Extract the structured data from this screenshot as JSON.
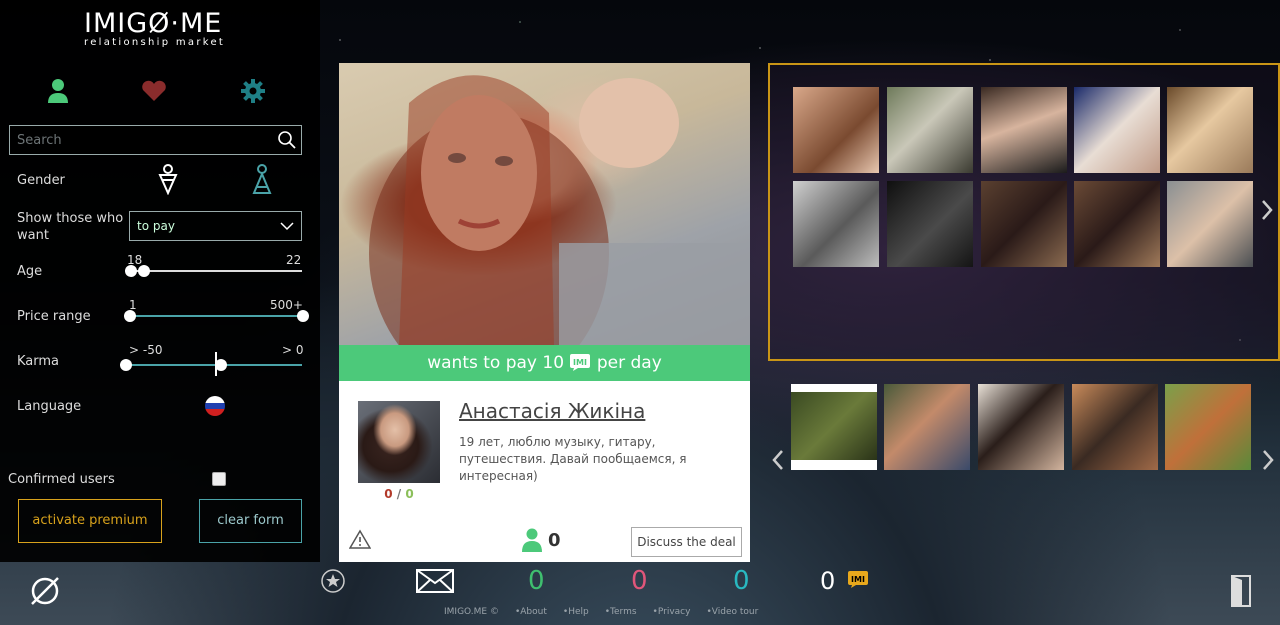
{
  "logo": {
    "main": "IMIGØ·ME",
    "sub": "relationship market"
  },
  "sidebar": {
    "tabs": [
      {
        "icon": "user-icon",
        "color": "#4cc97a"
      },
      {
        "icon": "heart-icon",
        "color": "#8a2c2c"
      },
      {
        "icon": "settings-gear-icon",
        "color": "#1f7f86"
      }
    ],
    "search_placeholder": "Search",
    "gender_label": "Gender",
    "show_label": "Show those who want",
    "show_value": "to pay",
    "age_label": "Age",
    "age_min": "18",
    "age_max": "22",
    "price_label": "Price range",
    "price_min": "1",
    "price_max": "500+",
    "karma_label": "Karma",
    "karma_min": "> -50",
    "karma_max": "> 0",
    "language_label": "Language",
    "confirmed_label": "Confirmed users",
    "premium_button": "activate premium",
    "clear_button": "clear form"
  },
  "profile": {
    "deal_prefix": "wants to pay 10",
    "deal_suffix": "per day",
    "name": "Анастасія Жикіна",
    "bio": "19 лет, люблю музыку, гитару, путешествия. Давай пообщаемся, я интересная)",
    "counts_red": "0",
    "counts_sep": " / ",
    "counts_green": "0",
    "likes": "0",
    "discuss_button": "Discuss the deal"
  },
  "bottom": {
    "counters": [
      {
        "value": "0",
        "color": "#3fbf6f"
      },
      {
        "value": "0",
        "color": "#e0567a"
      },
      {
        "value": "0",
        "color": "#29b8c0"
      },
      {
        "value": "0",
        "color": "#ffffff"
      }
    ],
    "footer": [
      "IMIGO.ME ©",
      "About",
      "Help",
      "Terms",
      "Privacy",
      "Video tour"
    ]
  },
  "colors": {
    "accent_green": "#4cc97a",
    "accent_gold": "#c99516",
    "accent_teal": "#4aa3a8"
  }
}
